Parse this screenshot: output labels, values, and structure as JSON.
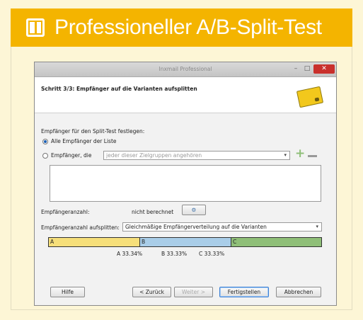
{
  "banner": {
    "title": "Professioneller A/B-Split-Test"
  },
  "window": {
    "title": "Inxmail Professional",
    "step_title": "Schritt 3/3: Empfänger auf die Varianten aufsplitten",
    "recipients_label": "Empfänger für den Split-Test festlegen:",
    "radio_all": "Alle Empfänger der Liste",
    "radio_target": "Empfänger, die",
    "target_placeholder": "jeder dieser Zielgruppen angehören",
    "count_label": "Empfängeranzahl:",
    "count_value": "nicht berechnet",
    "split_label": "Empfängeranzahl aufsplitten:",
    "split_value": "Gleichmäßige Empfängerverteilung auf die Varianten",
    "variants": [
      {
        "name": "A",
        "percent": "A 33.34%",
        "color": "#f6df7a",
        "share": 33.34
      },
      {
        "name": "B",
        "percent": "B 33.33%",
        "color": "#a9cde8",
        "share": 33.33
      },
      {
        "name": "C",
        "percent": "C 33.33%",
        "color": "#8fbf78",
        "share": 33.33
      }
    ],
    "buttons": {
      "help": "Hilfe",
      "back": "< Zurück",
      "next": "Weiter >",
      "finish": "Fertigstellen",
      "cancel": "Abbrechen"
    },
    "window_controls": {
      "minimize": "–",
      "maximize": "□",
      "close": "✕"
    },
    "icons": [
      "card-icon",
      "plus-icon",
      "minus-icon",
      "calculate-icon",
      "dropdown-arrow-icon"
    ]
  }
}
